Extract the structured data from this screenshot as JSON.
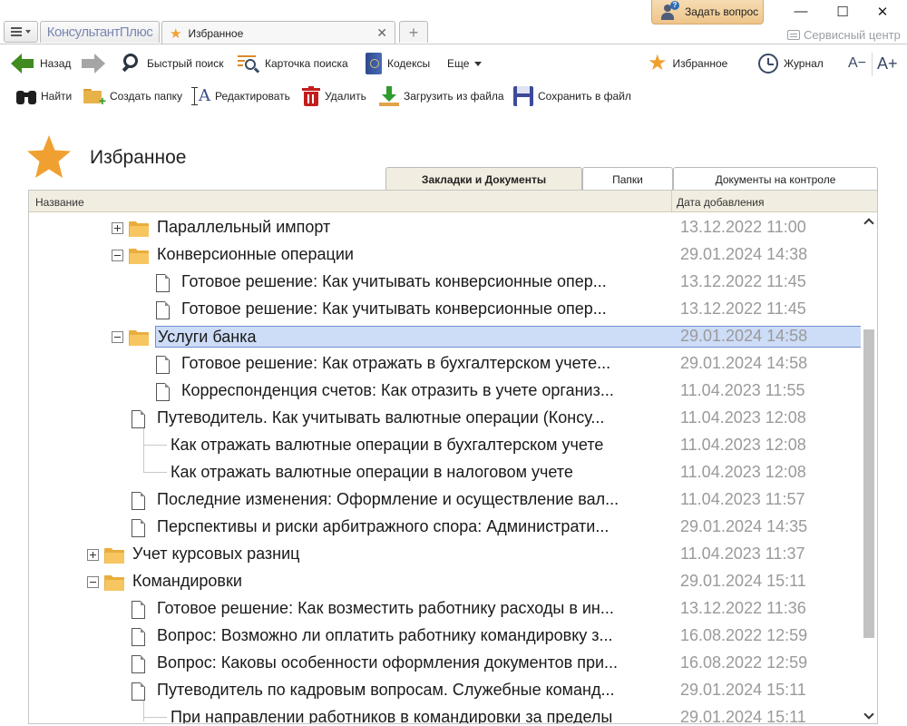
{
  "app": {
    "logo": "КонсультантПлюс",
    "tab_title": "Избранное",
    "ask_button": "Задать вопрос",
    "service_center": "Сервисный центр",
    "controls": {
      "minimize": "—",
      "maximize": "☐",
      "close": "✕"
    }
  },
  "nav": {
    "back": "Назад",
    "quick_search": "Быстрый поиск",
    "search_card": "Карточка поиска",
    "codexes": "Кодексы",
    "more": "Еще",
    "favorites": "Избранное",
    "journal": "Журнал",
    "font_smaller": "A−",
    "font_larger": "A+"
  },
  "actions": {
    "find": "Найти",
    "create_folder": "Создать папку",
    "edit": "Редактировать",
    "delete": "Удалить",
    "load_from_file": "Загрузить из файла",
    "save_to_file": "Сохранить в файл"
  },
  "page": {
    "title": "Избранное",
    "tabs": [
      {
        "label": "Закладки и Документы",
        "active": true
      },
      {
        "label": "Папки",
        "active": false
      },
      {
        "label": "Документы на контроле",
        "active": false
      }
    ]
  },
  "grid": {
    "columns": {
      "name": "Название",
      "date": "Дата добавления"
    },
    "rows": [
      {
        "type": "folder",
        "expander": "plus",
        "name": "Параллельный импорт",
        "date": "13.12.2022 11:00"
      },
      {
        "type": "folder",
        "expander": "minus",
        "name": "Конверсионные операции",
        "date": "29.01.2024 14:38"
      },
      {
        "type": "doc",
        "name": "Готовое решение: Как учитывать конверсионные опер...",
        "date": "13.12.2022 11:45"
      },
      {
        "type": "doc",
        "name": "Готовое решение: Как учитывать конверсионные опер...",
        "date": "13.12.2022 11:45"
      },
      {
        "type": "folder",
        "expander": "minus",
        "name": "Услуги банка",
        "date": "29.01.2024 14:58",
        "selected": true
      },
      {
        "type": "doc",
        "name": "Готовое решение: Как отражать в бухгалтерском учете...",
        "date": "29.01.2024 14:58"
      },
      {
        "type": "doc",
        "name": "Корреспонденция счетов: Как отразить в учете организ...",
        "date": "11.04.2023 11:55"
      },
      {
        "type": "doc",
        "name": "Путеводитель. Как учитывать валютные операции (Консу...",
        "date": "11.04.2023 12:08"
      },
      {
        "type": "bookmark",
        "name": "Как отражать валютные операции в бухгалтерском учете",
        "date": "11.04.2023 12:08"
      },
      {
        "type": "bookmark",
        "name": "Как отражать валютные операции в налоговом учете",
        "date": "11.04.2023 12:08"
      },
      {
        "type": "doc",
        "name": "Последние изменения: Оформление и осуществление вал...",
        "date": "11.04.2023 11:57"
      },
      {
        "type": "doc",
        "name": "Перспективы и риски арбитражного спора: Администрати...",
        "date": "29.01.2024 14:35"
      },
      {
        "type": "folder",
        "expander": "plus",
        "name": "Учет курсовых разниц",
        "date": "11.04.2023 11:37"
      },
      {
        "type": "folder",
        "expander": "minus",
        "name": "Командировки",
        "date": "29.01.2024 15:11"
      },
      {
        "type": "doc",
        "name": "Готовое решение: Как возместить работнику расходы в ин...",
        "date": "13.12.2022 11:36"
      },
      {
        "type": "doc",
        "name": "Вопрос: Возможно ли оплатить работнику командировку з...",
        "date": "16.08.2022 12:59"
      },
      {
        "type": "doc",
        "name": "Вопрос: Каковы особенности оформления документов при...",
        "date": "16.08.2022 12:59"
      },
      {
        "type": "doc",
        "name": "Путеводитель по кадровым вопросам. Служебные команд...",
        "date": "29.01.2024 15:11"
      },
      {
        "type": "bookmark",
        "name": "При направлении работников в командировки за пределы",
        "date": "29.01.2024 15:11"
      }
    ]
  },
  "colors": {
    "accent_star": "#f0a030",
    "selection": "#cddcf7",
    "header_bg": "#f1ede0",
    "date_text": "#9a9a9a"
  }
}
